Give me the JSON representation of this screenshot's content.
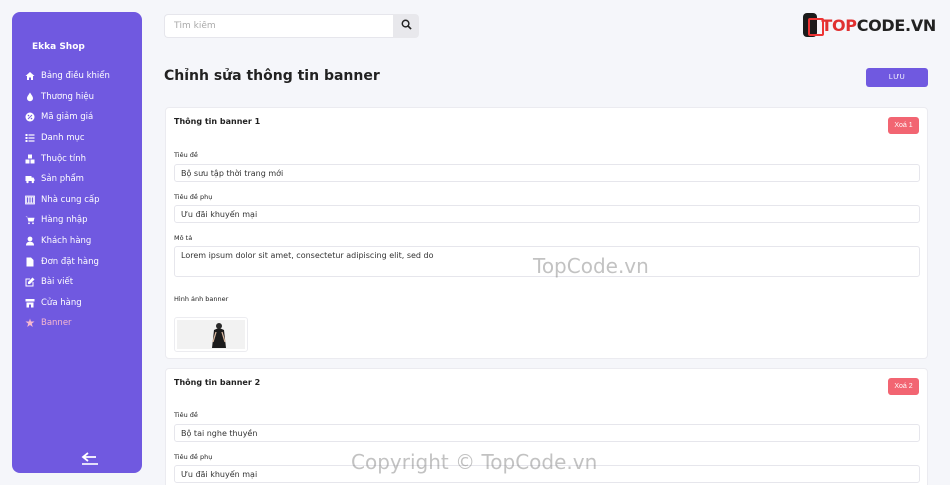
{
  "sidebar": {
    "brand": "Ekka Shop",
    "items": [
      {
        "label": "Bảng điều khiển",
        "icon": "home-icon"
      },
      {
        "label": "Thương hiệu",
        "icon": "droplet-icon"
      },
      {
        "label": "Mã giảm giá",
        "icon": "discount-icon"
      },
      {
        "label": "Danh mục",
        "icon": "list-icon"
      },
      {
        "label": "Thuộc tính",
        "icon": "cubes-icon"
      },
      {
        "label": "Sản phẩm",
        "icon": "truck-icon"
      },
      {
        "label": "Nhà cung cấp",
        "icon": "grid-icon"
      },
      {
        "label": "Hàng nhập",
        "icon": "cart-icon"
      },
      {
        "label": "Khách hàng",
        "icon": "user-icon"
      },
      {
        "label": "Đơn đặt hàng",
        "icon": "file-icon"
      },
      {
        "label": "Bài viết",
        "icon": "edit-icon"
      },
      {
        "label": "Cửa hàng",
        "icon": "store-icon"
      },
      {
        "label": "Banner",
        "icon": "banner-icon",
        "active": true
      }
    ],
    "logout_icon": "logout-arrow-icon"
  },
  "search": {
    "placeholder": "Tìm kiếm",
    "value": "",
    "icon": "search-icon"
  },
  "logo": {
    "text_red": "TOP",
    "text_dark": "CODE.VN"
  },
  "page": {
    "title": "Chỉnh sửa thông tin banner",
    "save_label": "LƯU"
  },
  "banners": [
    {
      "heading": "Thông tin banner 1",
      "delete_label": "Xoá 1",
      "title_label": "Tiêu đề",
      "title_value": "Bộ sưu tập thời trang mới",
      "subtitle_label": "Tiêu đề phụ",
      "subtitle_value": "Ưu đãi khuyến mại",
      "desc_label": "Mô tả",
      "desc_value": "Lorem ipsum dolor sit amet, consectetur adipiscing elit, sed do",
      "image_label": "Hình ảnh banner"
    },
    {
      "heading": "Thông tin banner 2",
      "delete_label": "Xoá 2",
      "title_label": "Tiêu đề",
      "title_value": "Bộ tai nghe thuyền",
      "subtitle_label": "Tiêu đề phụ",
      "subtitle_value": "Ưu đãi khuyến mại"
    }
  ],
  "watermarks": {
    "center": "TopCode.vn",
    "bottom": "Copyright © TopCode.vn"
  },
  "colors": {
    "accent": "#7059e0",
    "danger": "#f26572",
    "active_menu": "#f6b8d0"
  }
}
